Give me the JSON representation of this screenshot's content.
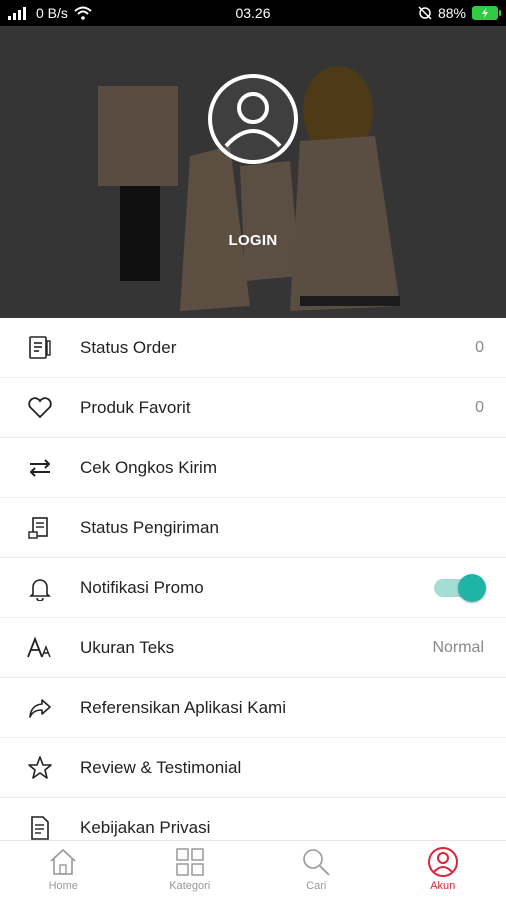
{
  "status_bar": {
    "left": "0 B/s",
    "time": "03.26",
    "battery": "88%"
  },
  "hero": {
    "login_label": "LOGIN"
  },
  "menu": [
    {
      "name": "status-order",
      "label": "Status Order",
      "value": "0",
      "icon": "order-list-icon"
    },
    {
      "name": "produk-favorit",
      "label": "Produk Favorit",
      "value": "0",
      "icon": "heart-icon"
    },
    {
      "name": "cek-ongkos-kirim",
      "label": "Cek Ongkos Kirim",
      "value": "",
      "icon": "swap-arrows-icon"
    },
    {
      "name": "status-pengiriman",
      "label": "Status Pengiriman",
      "value": "",
      "icon": "shipping-list-icon"
    },
    {
      "name": "notifikasi-promo",
      "label": "Notifikasi Promo",
      "value": "",
      "icon": "bell-icon",
      "toggle": true
    },
    {
      "name": "ukuran-teks",
      "label": "Ukuran Teks",
      "value": "Normal",
      "icon": "text-size-icon"
    },
    {
      "name": "referensikan",
      "label": "Referensikan Aplikasi Kami",
      "value": "",
      "icon": "share-arrow-icon"
    },
    {
      "name": "review-testimonial",
      "label": "Review & Testimonial",
      "value": "",
      "icon": "star-icon"
    },
    {
      "name": "kebijakan-privasi",
      "label": "Kebijakan Privasi",
      "value": "",
      "icon": "document-icon"
    }
  ],
  "bottom_nav": {
    "home": "Home",
    "kategori": "Kategori",
    "cari": "Cari",
    "akun": "Akun"
  },
  "colors": {
    "accent_red": "#d9243a",
    "toggle_teal": "#1fb5a6"
  }
}
